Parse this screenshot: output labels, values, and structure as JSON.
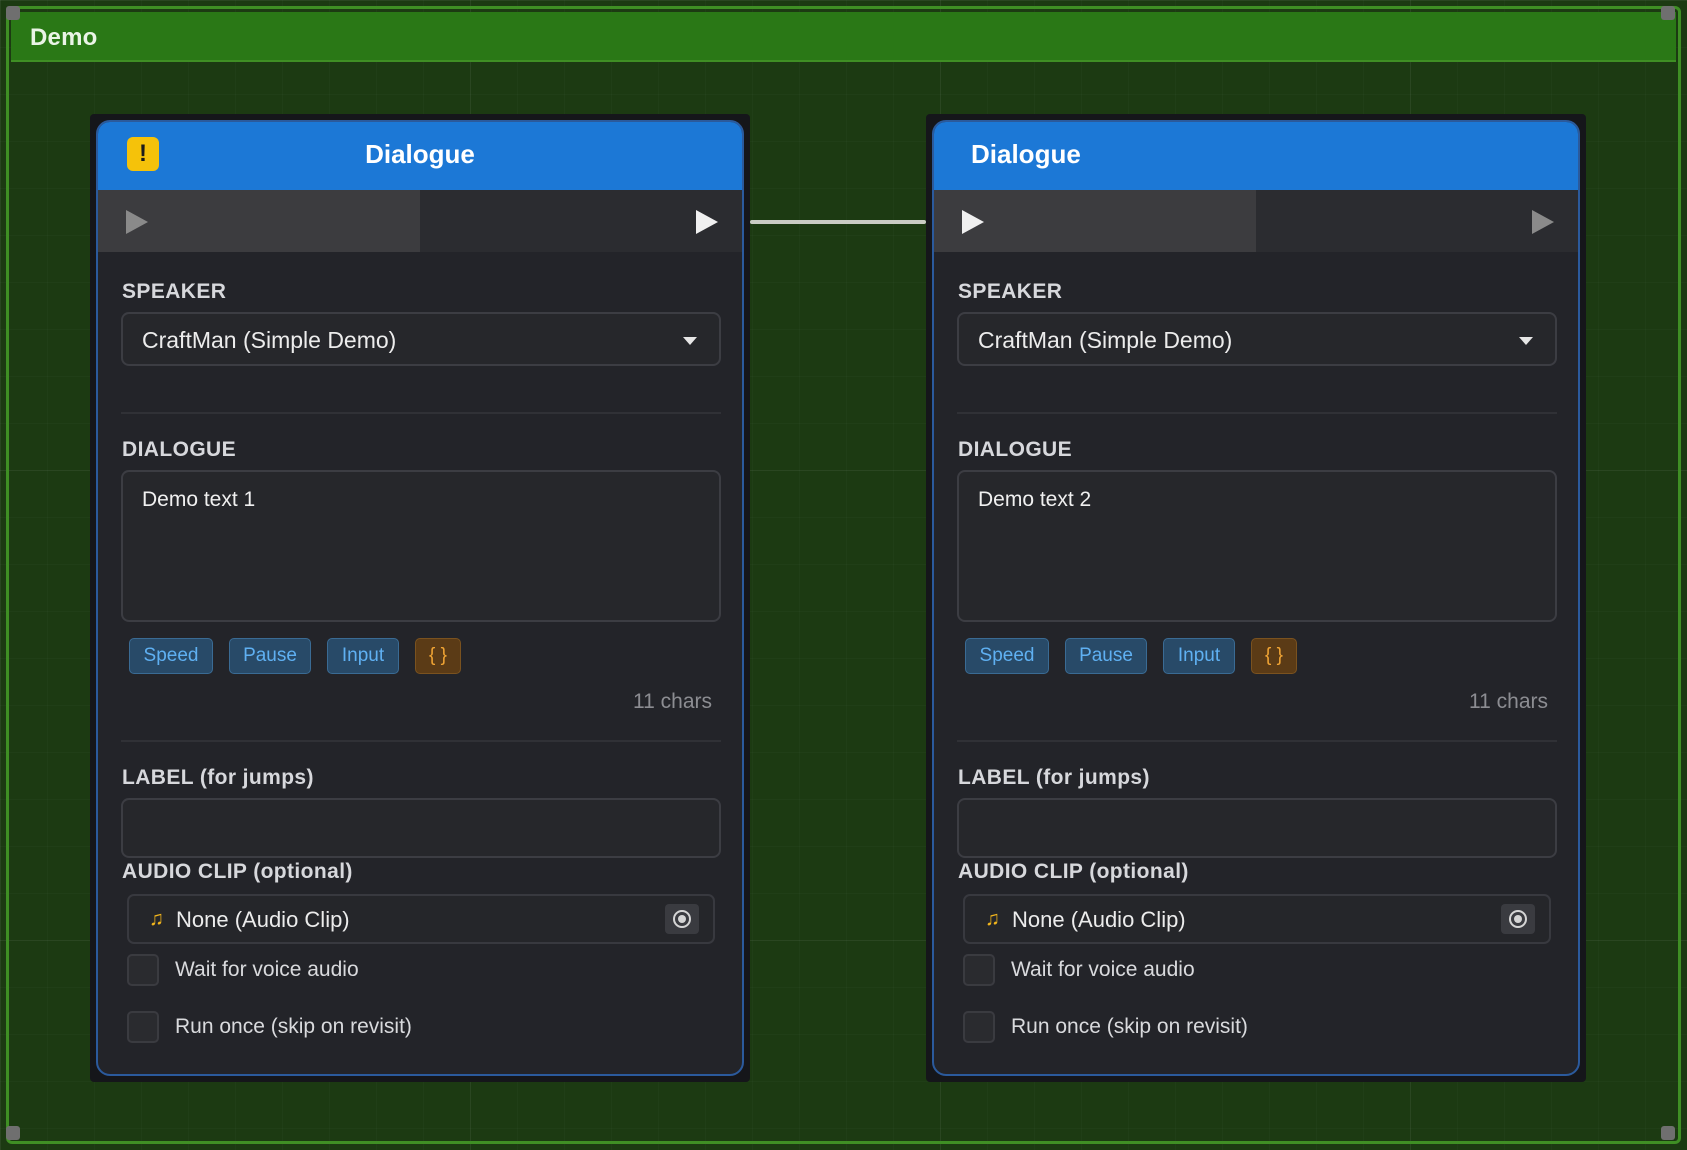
{
  "group": {
    "title": "Demo"
  },
  "nodes": [
    {
      "title": "Dialogue",
      "warning_icon": "!",
      "speaker_label": "SPEAKER",
      "speaker_value": "CraftMan (Simple Demo)",
      "dialogue_label": "DIALOGUE",
      "dialogue_text": "Demo text 1",
      "chips": [
        "Speed",
        "Pause",
        "Input",
        "{ }"
      ],
      "char_count": "11 chars",
      "label_field_label": "LABEL (for jumps)",
      "label_value": "",
      "audio_label": "AUDIO CLIP (optional)",
      "audio_value": "None (Audio Clip)",
      "wait_label": "Wait for voice audio",
      "wait_checked": false,
      "run_once_label": "Run once (skip on revisit)",
      "run_once_checked": false
    },
    {
      "title": "Dialogue",
      "speaker_label": "SPEAKER",
      "speaker_value": "CraftMan (Simple Demo)",
      "dialogue_label": "DIALOGUE",
      "dialogue_text": "Demo text 2",
      "chips": [
        "Speed",
        "Pause",
        "Input",
        "{ }"
      ],
      "char_count": "11 chars",
      "label_field_label": "LABEL (for jumps)",
      "label_value": "",
      "audio_label": "AUDIO CLIP (optional)",
      "audio_value": "None (Audio Clip)",
      "wait_label": "Wait for voice audio",
      "wait_checked": false,
      "run_once_label": "Run once (skip on revisit)",
      "run_once_checked": false
    }
  ],
  "icons": {
    "warning": "warning-icon",
    "input_port": "play-input-icon",
    "output_port": "play-output-icon",
    "dropdown": "chevron-down-icon",
    "audio": "music-note-icon",
    "picker": "object-picker-icon"
  },
  "colors": {
    "group_header": "#2a7816",
    "node_header": "#1c78d6",
    "node_body": "#232429",
    "chip_blue": "#5fb0f2",
    "chip_orange": "#f0a434",
    "warning": "#f5c20a"
  }
}
